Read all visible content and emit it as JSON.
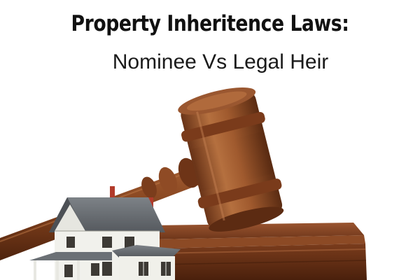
{
  "header": {
    "title": "Property Inheritence Laws:",
    "subtitle": "Nominee Vs Legal Heir"
  },
  "illustration": {
    "objects": [
      "gavel-icon",
      "sound-block",
      "house-model"
    ],
    "colors": {
      "wood_light": "#b06a3c",
      "wood_mid": "#8a4a26",
      "wood_dark": "#5e2e14",
      "roof": "#6e7378",
      "house_wall": "#f2f2ee",
      "chimney": "#b23a2a"
    }
  }
}
